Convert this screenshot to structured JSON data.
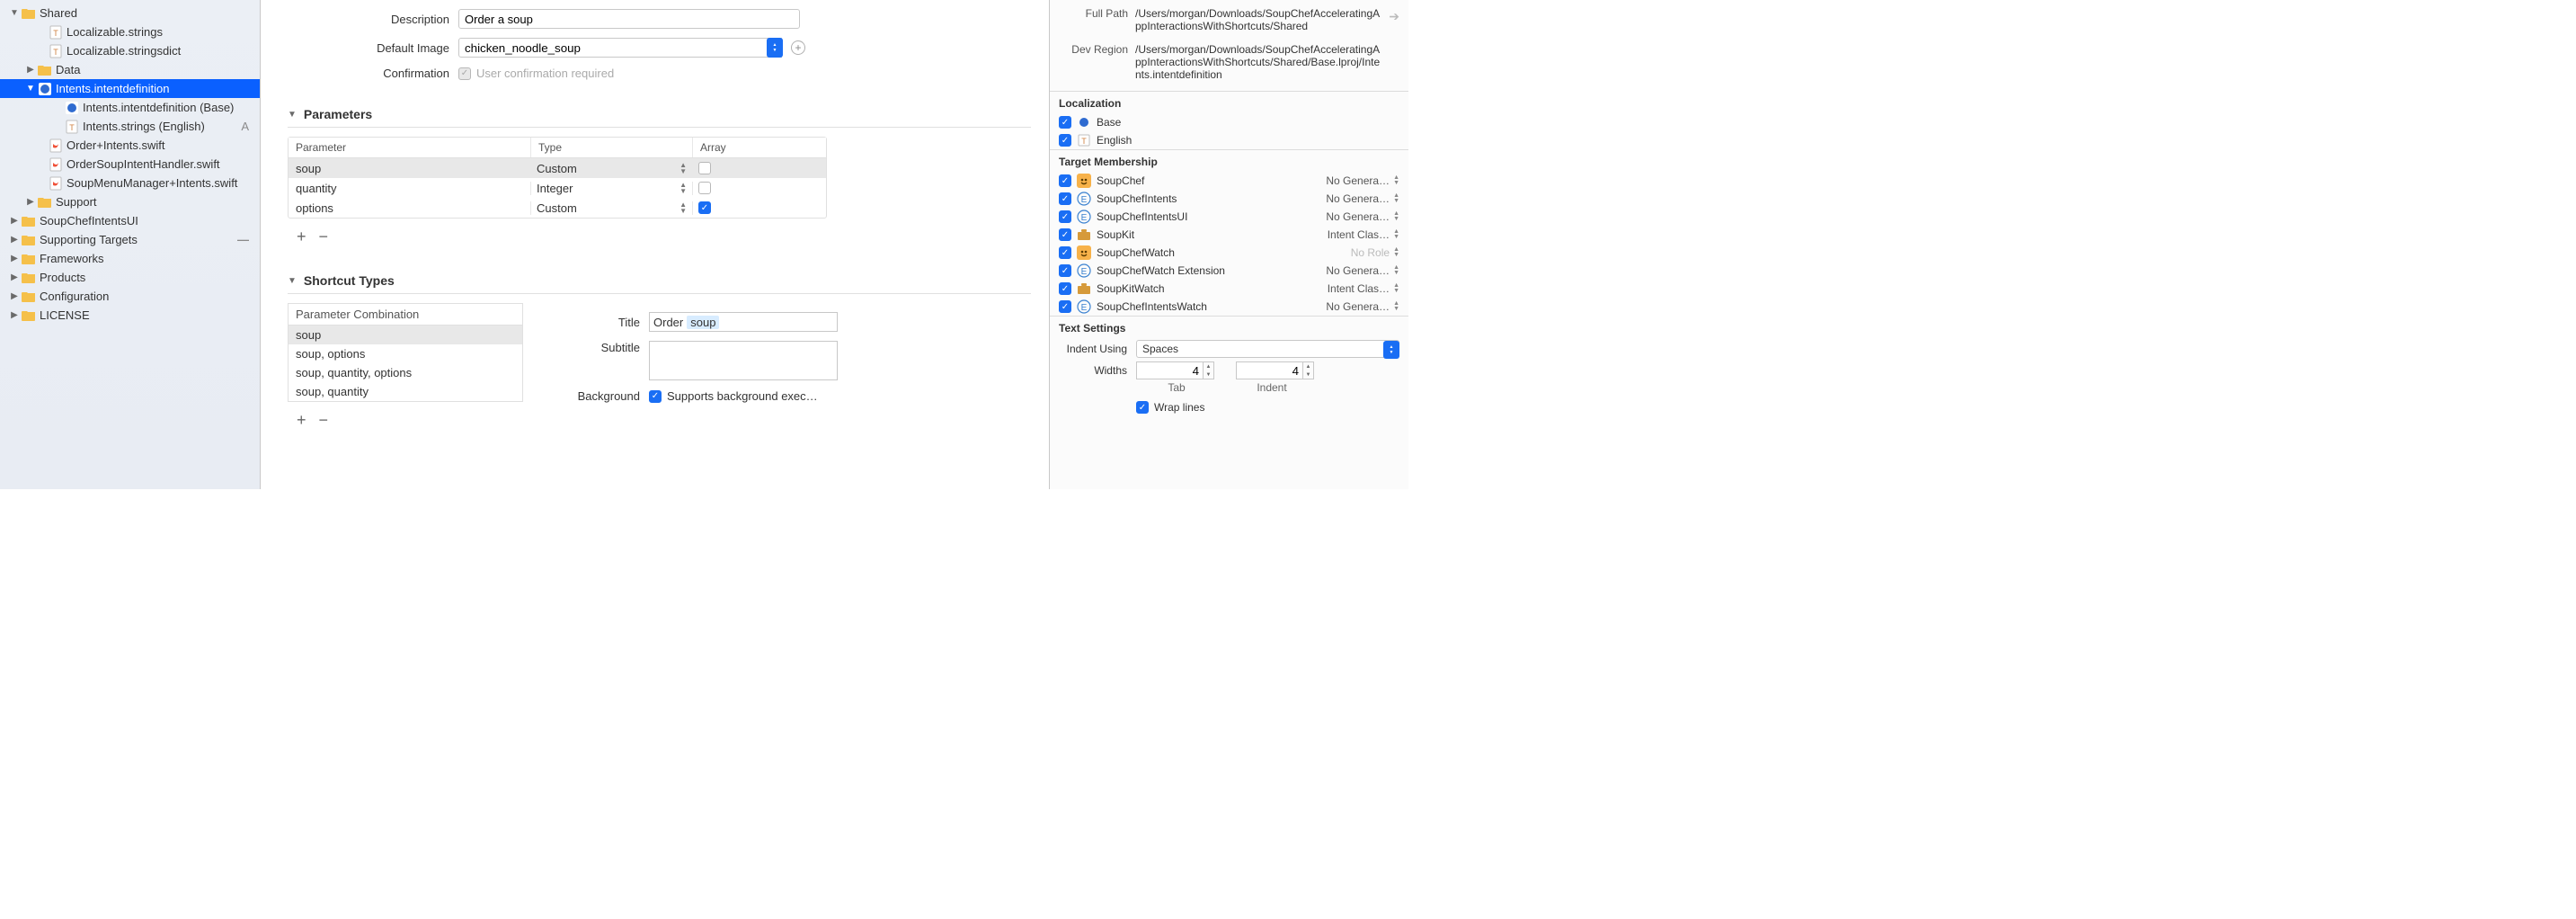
{
  "nav": {
    "root": "Shared",
    "items": [
      {
        "label": "Localizable.strings"
      },
      {
        "label": "Localizable.stringsdict"
      },
      {
        "label": "Data"
      },
      {
        "label": "Intents.intentdefinition"
      },
      {
        "label": "Intents.intentdefinition (Base)"
      },
      {
        "label": "Intents.strings (English)"
      },
      {
        "label": "Order+Intents.swift"
      },
      {
        "label": "OrderSoupIntentHandler.swift"
      },
      {
        "label": "SoupMenuManager+Intents.swift"
      },
      {
        "label": "Support"
      },
      {
        "label": "SoupChefIntentsUI"
      },
      {
        "label": "Supporting Targets"
      },
      {
        "label": "Frameworks"
      },
      {
        "label": "Products"
      },
      {
        "label": "Configuration"
      },
      {
        "label": "LICENSE"
      }
    ]
  },
  "editor": {
    "description_label": "Description",
    "description_value": "Order a soup",
    "default_image_label": "Default Image",
    "default_image_value": "chicken_noodle_soup",
    "confirmation_label": "Confirmation",
    "confirmation_text": "User confirmation required",
    "parameters_heading": "Parameters",
    "param_headers": {
      "name": "Parameter",
      "type": "Type",
      "array": "Array"
    },
    "params": [
      {
        "name": "soup",
        "type": "Custom",
        "array": false
      },
      {
        "name": "quantity",
        "type": "Integer",
        "array": false
      },
      {
        "name": "options",
        "type": "Custom",
        "array": true
      }
    ],
    "shortcut_heading": "Shortcut Types",
    "combo_header": "Parameter Combination",
    "combos": [
      "soup",
      "soup, options",
      "soup, quantity, options",
      "soup, quantity"
    ],
    "title_label": "Title",
    "title_static": "Order",
    "title_token": "soup",
    "subtitle_label": "Subtitle",
    "background_label": "Background",
    "background_text": "Supports background exec…"
  },
  "inspector": {
    "full_path_label": "Full Path",
    "full_path": "/Users/morgan/Downloads/SoupChefAcceleratingAppInteractionsWithShortcuts/Shared",
    "dev_region_label": "Dev Region",
    "dev_region": "/Users/morgan/Downloads/SoupChefAcceleratingAppInteractionsWithShortcuts/Shared/Base.lproj/Intents.intentdefinition",
    "localization_heading": "Localization",
    "localizations": [
      "Base",
      "English"
    ],
    "target_heading": "Target Membership",
    "targets": [
      {
        "name": "SoupChef",
        "role": "No Genera…",
        "icon": "app"
      },
      {
        "name": "SoupChefIntents",
        "role": "No Genera…",
        "icon": "ext"
      },
      {
        "name": "SoupChefIntentsUI",
        "role": "No Genera…",
        "icon": "ext"
      },
      {
        "name": "SoupKit",
        "role": "Intent Clas…",
        "icon": "kit"
      },
      {
        "name": "SoupChefWatch",
        "role": "No Role",
        "icon": "app"
      },
      {
        "name": "SoupChefWatch Extension",
        "role": "No Genera…",
        "icon": "ext"
      },
      {
        "name": "SoupKitWatch",
        "role": "Intent Clas…",
        "icon": "kit"
      },
      {
        "name": "SoupChefIntentsWatch",
        "role": "No Genera…",
        "icon": "ext"
      }
    ],
    "text_settings_heading": "Text Settings",
    "indent_using_label": "Indent Using",
    "indent_using_value": "Spaces",
    "widths_label": "Widths",
    "tab_value": "4",
    "indent_value": "4",
    "tab_sublabel": "Tab",
    "indent_sublabel": "Indent",
    "wrap_label": "Wrap lines"
  }
}
